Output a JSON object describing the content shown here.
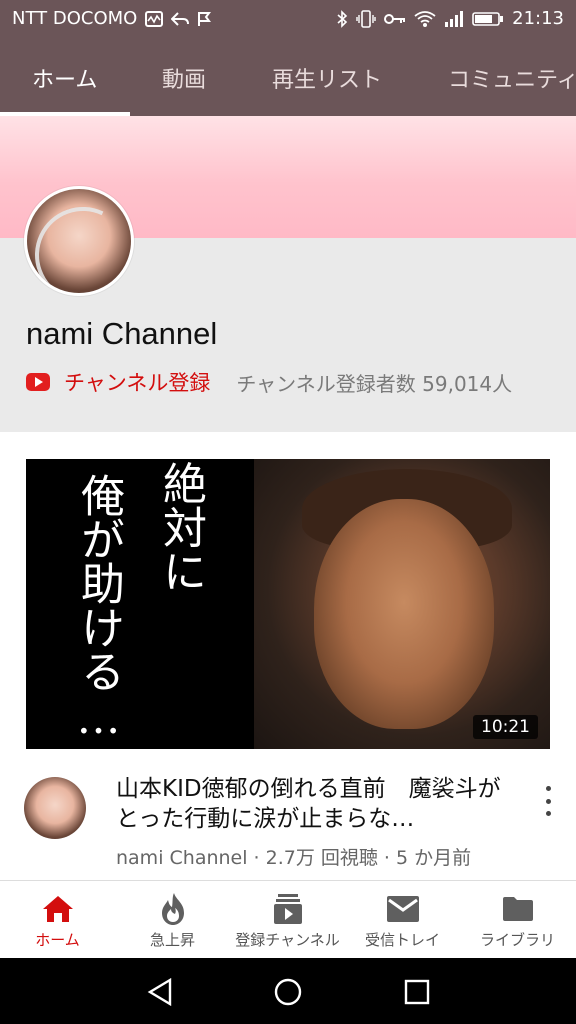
{
  "status_bar": {
    "carrier": "NTT DOCOMO",
    "time": "21:13"
  },
  "tabs": [
    {
      "label": "ホーム",
      "active": true
    },
    {
      "label": "動画",
      "active": false
    },
    {
      "label": "再生リスト",
      "active": false
    },
    {
      "label": "コミュニティ",
      "active": false
    }
  ],
  "channel": {
    "name": "nami Channel",
    "subscribe_label": "チャンネル登録",
    "subscriber_count": "チャンネル登録者数 59,014人"
  },
  "video": {
    "thumbnail_text_col1": "絶対に",
    "thumbnail_text_col2": "俺が助ける…",
    "duration": "10:21",
    "title": "山本KID徳郁の倒れる直前　魔裟斗がとった行動に涙が止まらな…",
    "meta": "nami Channel · 2.7万 回視聴 · 5 か月前"
  },
  "bottom_nav": [
    {
      "label": "ホーム",
      "icon": "home-icon",
      "active": true
    },
    {
      "label": "急上昇",
      "icon": "trending-flame-icon",
      "active": false
    },
    {
      "label": "登録チャンネル",
      "icon": "subscriptions-icon",
      "active": false
    },
    {
      "label": "受信トレイ",
      "icon": "inbox-mail-icon",
      "active": false
    },
    {
      "label": "ライブラリ",
      "icon": "library-folder-icon",
      "active": false
    }
  ],
  "colors": {
    "header_bg": "#6b5558",
    "accent_red": "#d30e0e",
    "banner_pink": "#ffc3cd",
    "header_area_bg": "#eaeaea"
  }
}
